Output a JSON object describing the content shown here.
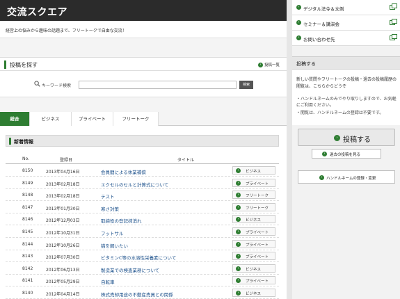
{
  "header": {
    "title": "交流スクエア",
    "subtitle": "経営上の悩みから趣味の話題まで、フリートークで自由な交流！"
  },
  "search": {
    "heading": "投稿を探す",
    "list_link": "投稿一覧",
    "keyword_label": "キーワード検索",
    "input_value": "",
    "button_label": "検索"
  },
  "tabs": [
    {
      "label": "総合"
    },
    {
      "label": "ビジネス"
    },
    {
      "label": "プライベート"
    },
    {
      "label": "フリートーク"
    }
  ],
  "news": {
    "heading": "新着情報",
    "columns": {
      "no": "No.",
      "date": "登録日",
      "title": "タイトル"
    },
    "rows": [
      {
        "no": "8150",
        "date": "2013年04月16日",
        "title": "会員間による休業補償",
        "category": "ビジネス"
      },
      {
        "no": "8149",
        "date": "2013年02月18日",
        "title": "エクセルのセルと計算式について",
        "category": "プライベート"
      },
      {
        "no": "8148",
        "date": "2013年02月18日",
        "title": "テスト",
        "category": "フリートーク"
      },
      {
        "no": "8147",
        "date": "2013年01月30日",
        "title": "寒さ対策",
        "category": "フリートーク"
      },
      {
        "no": "8146",
        "date": "2012年12月03日",
        "title": "取締役の登記抹消れ",
        "category": "ビジネス"
      },
      {
        "no": "8145",
        "date": "2012年10月31日",
        "title": "フットサル",
        "category": "プライベート"
      },
      {
        "no": "8144",
        "date": "2012年10月26日",
        "title": "猫を飼いたい",
        "category": "プライベート"
      },
      {
        "no": "8143",
        "date": "2012年07月30日",
        "title": "ビタミンC等の水溶性栄養素について",
        "category": "プライベート"
      },
      {
        "no": "8142",
        "date": "2012年06月13日",
        "title": "製造業での検査業務について",
        "category": "ビジネス"
      },
      {
        "no": "8141",
        "date": "2012年05月29日",
        "title": "自転車",
        "category": "プライベート"
      },
      {
        "no": "8140",
        "date": "2012年04月14日",
        "title": "株式売却用途の不動産売買との関係",
        "category": "ビジネス"
      }
    ]
  },
  "right_links": [
    {
      "label": "デジタル法令＆文例"
    },
    {
      "label": "セミナー＆講演会"
    },
    {
      "label": "お問い合わせ先"
    }
  ],
  "post": {
    "heading": "投稿する",
    "desc": "新しい質問やフリートークの投稿・過去の投稿履歴の閲覧は、こちらからどうぞ",
    "note1": "・ハンドルネームのみでやり取りしますので、お気軽にご利用ください。",
    "note2": "・閲覧は、ハンドルネームの登録は不要です。",
    "post_button": "投稿する",
    "history_button": "過去の投稿を見る",
    "handle_button": "ハンドルネームの登録・変更"
  },
  "colors": {
    "accent": "#2e7d32",
    "header_bg": "#2b2b2b",
    "link": "#1a4f8a"
  },
  "icons": {
    "bullet": "arrow-circle-icon",
    "search": "magnifier-icon",
    "external": "external-window-icon"
  }
}
